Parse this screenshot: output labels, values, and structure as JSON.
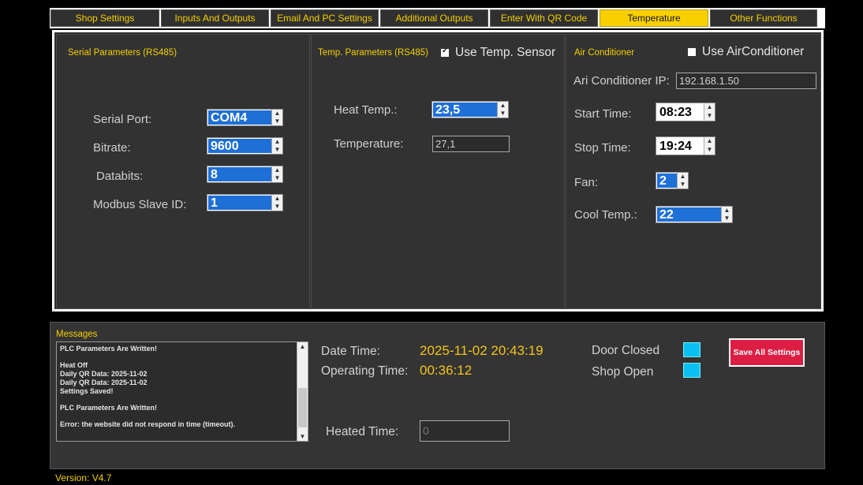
{
  "tabs": [
    "Shop Settings",
    "Inputs And Outputs",
    "Email And PC Settings",
    "Additional Outputs",
    "Enter With QR Code",
    "Temperature",
    "Other Functions"
  ],
  "active_tab": "Temperature",
  "serial": {
    "title": "Serial Parameters (RS485)",
    "port_label": "Serial Port:",
    "port_value": "COM4",
    "bitrate_label": "Bitrate:",
    "bitrate_value": "9600",
    "databits_label": "Databits:",
    "databits_value": "8",
    "slave_label": "Modbus Slave ID:",
    "slave_value": "1"
  },
  "temp": {
    "title": "Temp. Parameters (RS485)",
    "use_sensor_label": "Use Temp. Sensor",
    "use_sensor_checked": true,
    "heat_label": "Heat Temp.:",
    "heat_value": "23,5",
    "temperature_label": "Temperature:",
    "temperature_value": "27,1"
  },
  "ac": {
    "title": "Air Conditioner",
    "use_ac_label": "Use AirConditioner",
    "use_ac_checked": false,
    "ip_label": "Ari Conditioner IP:",
    "ip_value": "192.168.1.50",
    "start_label": "Start Time:",
    "start_value": "08:23",
    "stop_label": "Stop Time:",
    "stop_value": "19:24",
    "fan_label": "Fan:",
    "fan_value": "2",
    "cool_label": "Cool Temp.:",
    "cool_value": "22"
  },
  "messages": {
    "title": "Messages",
    "lines": [
      "PLC Parameters Are Written!",
      "",
      "Heat Off",
      "Daily QR Data: 2025-11-02",
      "Daily QR Data: 2025-11-02",
      "Settings Saved!",
      "",
      "PLC Parameters Are Written!",
      "",
      "Error: the website did not respond in time (timeout)."
    ]
  },
  "status": {
    "datetime_label": "Date  Time:",
    "datetime_value": "2025-11-02 20:43:19",
    "optime_label": "Operating Time:",
    "optime_value": "00:36:12",
    "door_label": "Door Closed",
    "shop_label": "Shop Open",
    "heated_label": "Heated Time:",
    "heated_value": "0",
    "indicator_color": "#0ac0f2"
  },
  "save_button": "Save All Settings",
  "version": "Version: V4.7"
}
